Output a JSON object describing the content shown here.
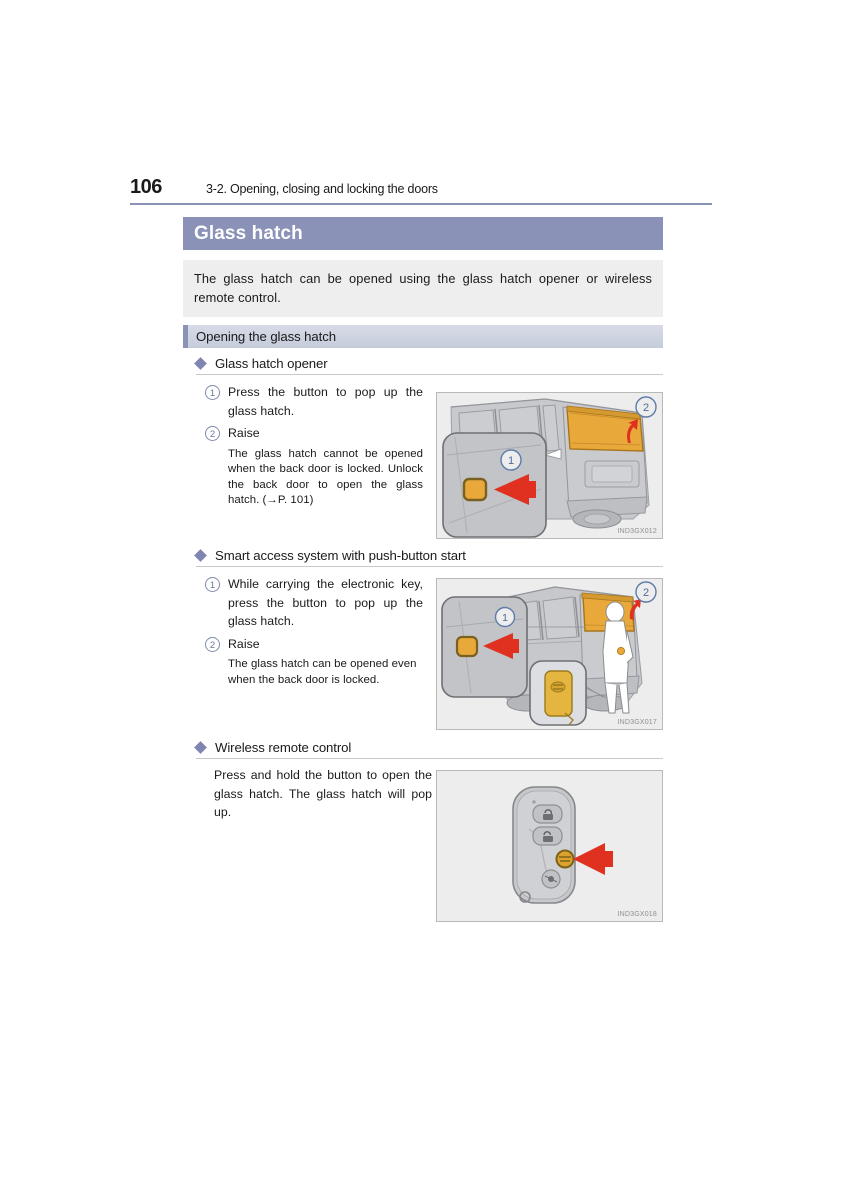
{
  "page": {
    "number": "106",
    "running_head": "3-2. Opening, closing and locking the doors"
  },
  "title_bar": {
    "label": "Glass hatch"
  },
  "intro": {
    "text": "The glass hatch can be opened using the glass hatch opener or wireless remote control."
  },
  "subsection": {
    "label": "Opening the glass hatch"
  },
  "sections": [
    {
      "heading": "Glass hatch opener",
      "steps": [
        {
          "number": "1",
          "text": "Press the button to pop up the glass hatch."
        },
        {
          "number": "2",
          "text": "Raise"
        }
      ],
      "note": "The glass hatch cannot be opened when the back door is locked. Unlock the back door to open the glass hatch. (→P. 101)",
      "figure_code": "IND3GX012"
    },
    {
      "heading": "Smart access system with push-button start",
      "steps": [
        {
          "number": "1",
          "text": "While carrying the electronic key, press the button to pop up the glass hatch."
        },
        {
          "number": "2",
          "text": "Raise"
        }
      ],
      "note": "The glass hatch can be opened even when the back door is locked.",
      "figure_code": "IND3GX017"
    },
    {
      "heading": "Wireless remote control",
      "paragraph": "Press and hold the button to open the glass hatch. The glass hatch will pop up.",
      "figure_code": "IND3GX018"
    }
  ],
  "figure_callouts": {
    "one": "1",
    "two": "2"
  },
  "colors": {
    "header_bar": "#8b92b8",
    "subsection_bar": "#ced3e1",
    "intro_background": "#eeeeee",
    "diamond_bullet": "#7e85ae",
    "callout_blue": "#6a7899",
    "highlight_orange": "#e9a83a",
    "arrow_red": "#e03020",
    "figure_background": "#ededed",
    "vehicle_gray": "#b8b9bc"
  }
}
